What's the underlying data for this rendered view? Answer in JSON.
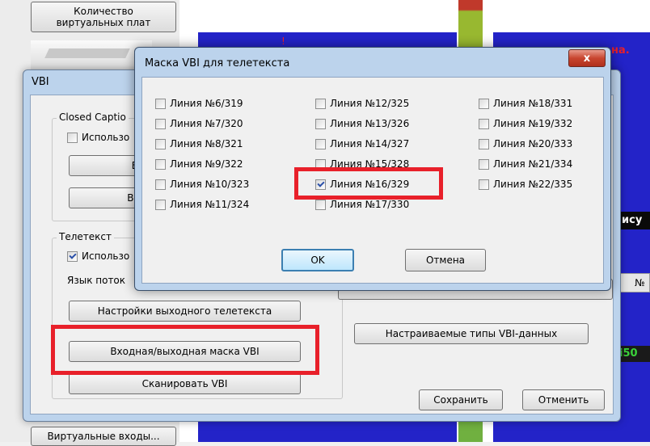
{
  "background": {
    "virtual_boards_button": "Количество\nвиртуальных плат",
    "virtual_inputs_button": "Виртуальные входы...",
    "right_fragment_1": "на.",
    "right_fragment_2": "ису",
    "right_fragment_3": "№",
    "right_fragment_4": "i50",
    "right_fragment_5": "!"
  },
  "vbi_window": {
    "title": "VBI",
    "closed_captions": {
      "legend": "Closed Captio",
      "use_label": "Использо",
      "use_checked": false,
      "button1_label": "В",
      "button2_label": "Вы"
    },
    "teletext": {
      "legend": "Телетекст",
      "use_label": "Использо",
      "use_checked": true,
      "stream_lang_label": "Язык поток",
      "output_settings_button": "Настройки выходного телетекста",
      "mask_button": "Входная/выходная маска VBI",
      "scan_button": "Сканировать VBI"
    },
    "custom_types_button": "Настраиваемые типы VBI-данных",
    "save_button": "Сохранить",
    "cancel_button": "Отменить"
  },
  "modal": {
    "title": "Маска VBI для телетекста",
    "close_label": "x",
    "ok_button": "OK",
    "cancel_button": "Отмена",
    "lines": [
      {
        "label": "Линия №6/319",
        "checked": false
      },
      {
        "label": "Линия №7/320",
        "checked": false
      },
      {
        "label": "Линия №8/321",
        "checked": false
      },
      {
        "label": "Линия №9/322",
        "checked": false
      },
      {
        "label": "Линия №10/323",
        "checked": false
      },
      {
        "label": "Линия №11/324",
        "checked": false
      },
      {
        "label": "Линия №12/325",
        "checked": false
      },
      {
        "label": "Линия №13/326",
        "checked": false
      },
      {
        "label": "Линия №14/327",
        "checked": false
      },
      {
        "label": "Линия №15/328",
        "checked": false
      },
      {
        "label": "Линия №16/329",
        "checked": true
      },
      {
        "label": "Линия №17/330",
        "checked": false
      },
      {
        "label": "Линия №18/331",
        "checked": false
      },
      {
        "label": "Линия №19/332",
        "checked": false
      },
      {
        "label": "Линия №20/333",
        "checked": false
      },
      {
        "label": "Линия №21/334",
        "checked": false
      },
      {
        "label": "Линия №22/335",
        "checked": false
      }
    ]
  },
  "colors": {
    "highlight_red": "#e8202a",
    "panel_blue": "#2323c8",
    "check_blue": "#2a4fa8"
  }
}
